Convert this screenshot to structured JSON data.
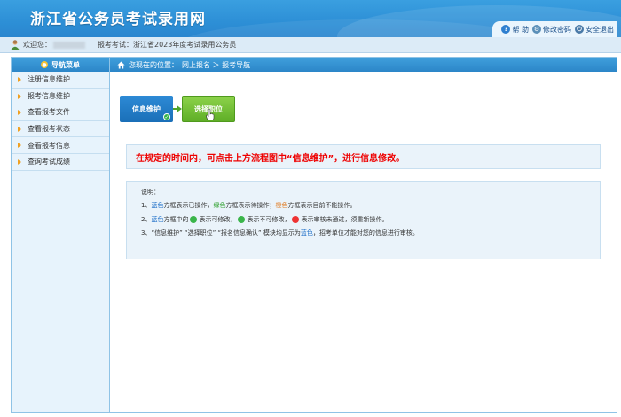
{
  "header": {
    "title": "浙江省公务员考试录用网",
    "links": [
      {
        "label": "帮 助",
        "icon": "help-icon"
      },
      {
        "label": "修改密码",
        "icon": "key-icon"
      },
      {
        "label": "安全退出",
        "icon": "power-icon"
      }
    ]
  },
  "info_bar": {
    "welcome": "欢迎您：",
    "exam_label": "报考考试：",
    "exam_name": "浙江省2023年度考试录用公务员"
  },
  "sidebar": {
    "title": "导航菜单",
    "items": [
      {
        "label": "注册信息维护"
      },
      {
        "label": "报考信息维护"
      },
      {
        "label": "查看报考文件"
      },
      {
        "label": "查看报考状态"
      },
      {
        "label": "查看报考信息"
      },
      {
        "label": "查询考试成绩"
      }
    ]
  },
  "breadcrumb": {
    "prefix": "您现在的位置：",
    "path": "网上报名 ＞ 报考导航"
  },
  "flow": {
    "step1": "信息维护",
    "step2": "选择职位"
  },
  "notice": "在规定的时间内，可点击上方流程图中“信息维护”，进行信息修改。",
  "explain": {
    "title": "说明：",
    "line1": {
      "n": "1、",
      "blue": "蓝色",
      "t1": "方框表示已操作，",
      "green": "绿色",
      "t2": "方框表示待操作；",
      "orange": "橙色",
      "t3": "方框表示目前不能操作。"
    },
    "line2": {
      "n": "2、",
      "blue": "蓝色",
      "t1": "方框中的",
      "t2": "表示可修改，",
      "t3": "表示不可修改，",
      "t4": "表示审核未通过，须重新操作。"
    },
    "line3": {
      "n": "3、",
      "t1": "“信息维护”  “选择职位”  “报名信息确认” 模块均显示为",
      "blue": "蓝色",
      "t2": "，招考单位才能对您的信息进行审核。"
    }
  },
  "colors": {
    "header_blue": "#2d8fd6",
    "sidebar_bg": "#e7f3fc",
    "notice_red": "#ee0000",
    "step_blue": "#1a6fb8",
    "step_green": "#5fae27"
  }
}
